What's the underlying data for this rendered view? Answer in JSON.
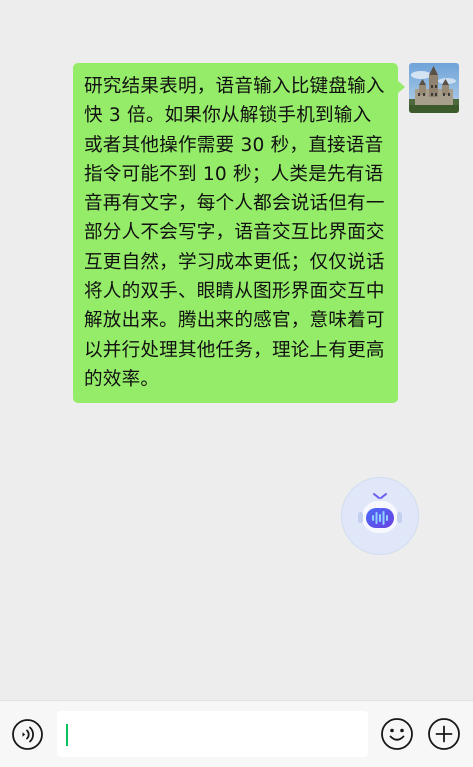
{
  "chat": {
    "messages": [
      {
        "sender": "self",
        "text": "研究结果表明，语音输入比键盘输入快 3 倍。如果你从解锁手机到输入或者其他操作需要 30 秒，直接语音指令可能不到 10 秒；人类是先有语音再有文字，每个人都会说话但有一部分人不会写字，语音交互比界面交互更自然，学习成本更低；仅仅说话将人的双手、眼睛从图形界面交互中解放出来。腾出来的感官，意味着可以并行处理其他任务，理论上有更高的效率。"
      }
    ]
  },
  "input_bar": {
    "text_value": "",
    "icons": {
      "voice": "voice-wave-icon",
      "emoji": "smiley-face-icon",
      "more": "plus-circle-icon"
    }
  },
  "floating": {
    "icon": "voice-assistant-robot-icon"
  },
  "colors": {
    "background": "#ededed",
    "bubble_self": "#95ec69",
    "caret": "#07c160",
    "bottom_bar": "#f7f7f7"
  }
}
